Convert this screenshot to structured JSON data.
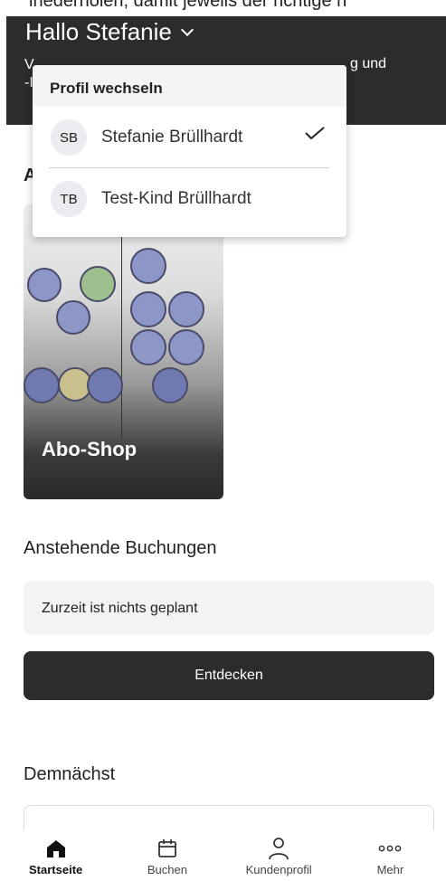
{
  "caption": {
    "text": "ihederholen, damit jeweils der richtige h"
  },
  "header": {
    "greeting": "Hallo Stefanie",
    "subtitle_left_1": "V",
    "subtitle_left_2": "-I",
    "subtitle_right": "g und"
  },
  "dropdown": {
    "title": "Profil wechseln",
    "profiles": [
      {
        "initials": "SB",
        "name": "Stefanie Brüllhardt",
        "selected": true
      },
      {
        "initials": "TB",
        "name": "Test-Kind Brüllhardt",
        "selected": false
      }
    ]
  },
  "section_a": {
    "label": "A"
  },
  "abo_card": {
    "title": "Abo-Shop"
  },
  "upcoming": {
    "heading": "Anstehende Buchungen",
    "empty_text": "Zurzeit ist nichts geplant",
    "button": "Entdecken"
  },
  "soon": {
    "heading": "Demnächst"
  },
  "nav": {
    "items": [
      {
        "label": "Startseite",
        "icon": "home-icon",
        "active": true
      },
      {
        "label": "Buchen",
        "icon": "calendar-icon",
        "active": false
      },
      {
        "label": "Kundenprofil",
        "icon": "user-icon",
        "active": false
      },
      {
        "label": "Mehr",
        "icon": "more-icon",
        "active": false
      }
    ]
  }
}
